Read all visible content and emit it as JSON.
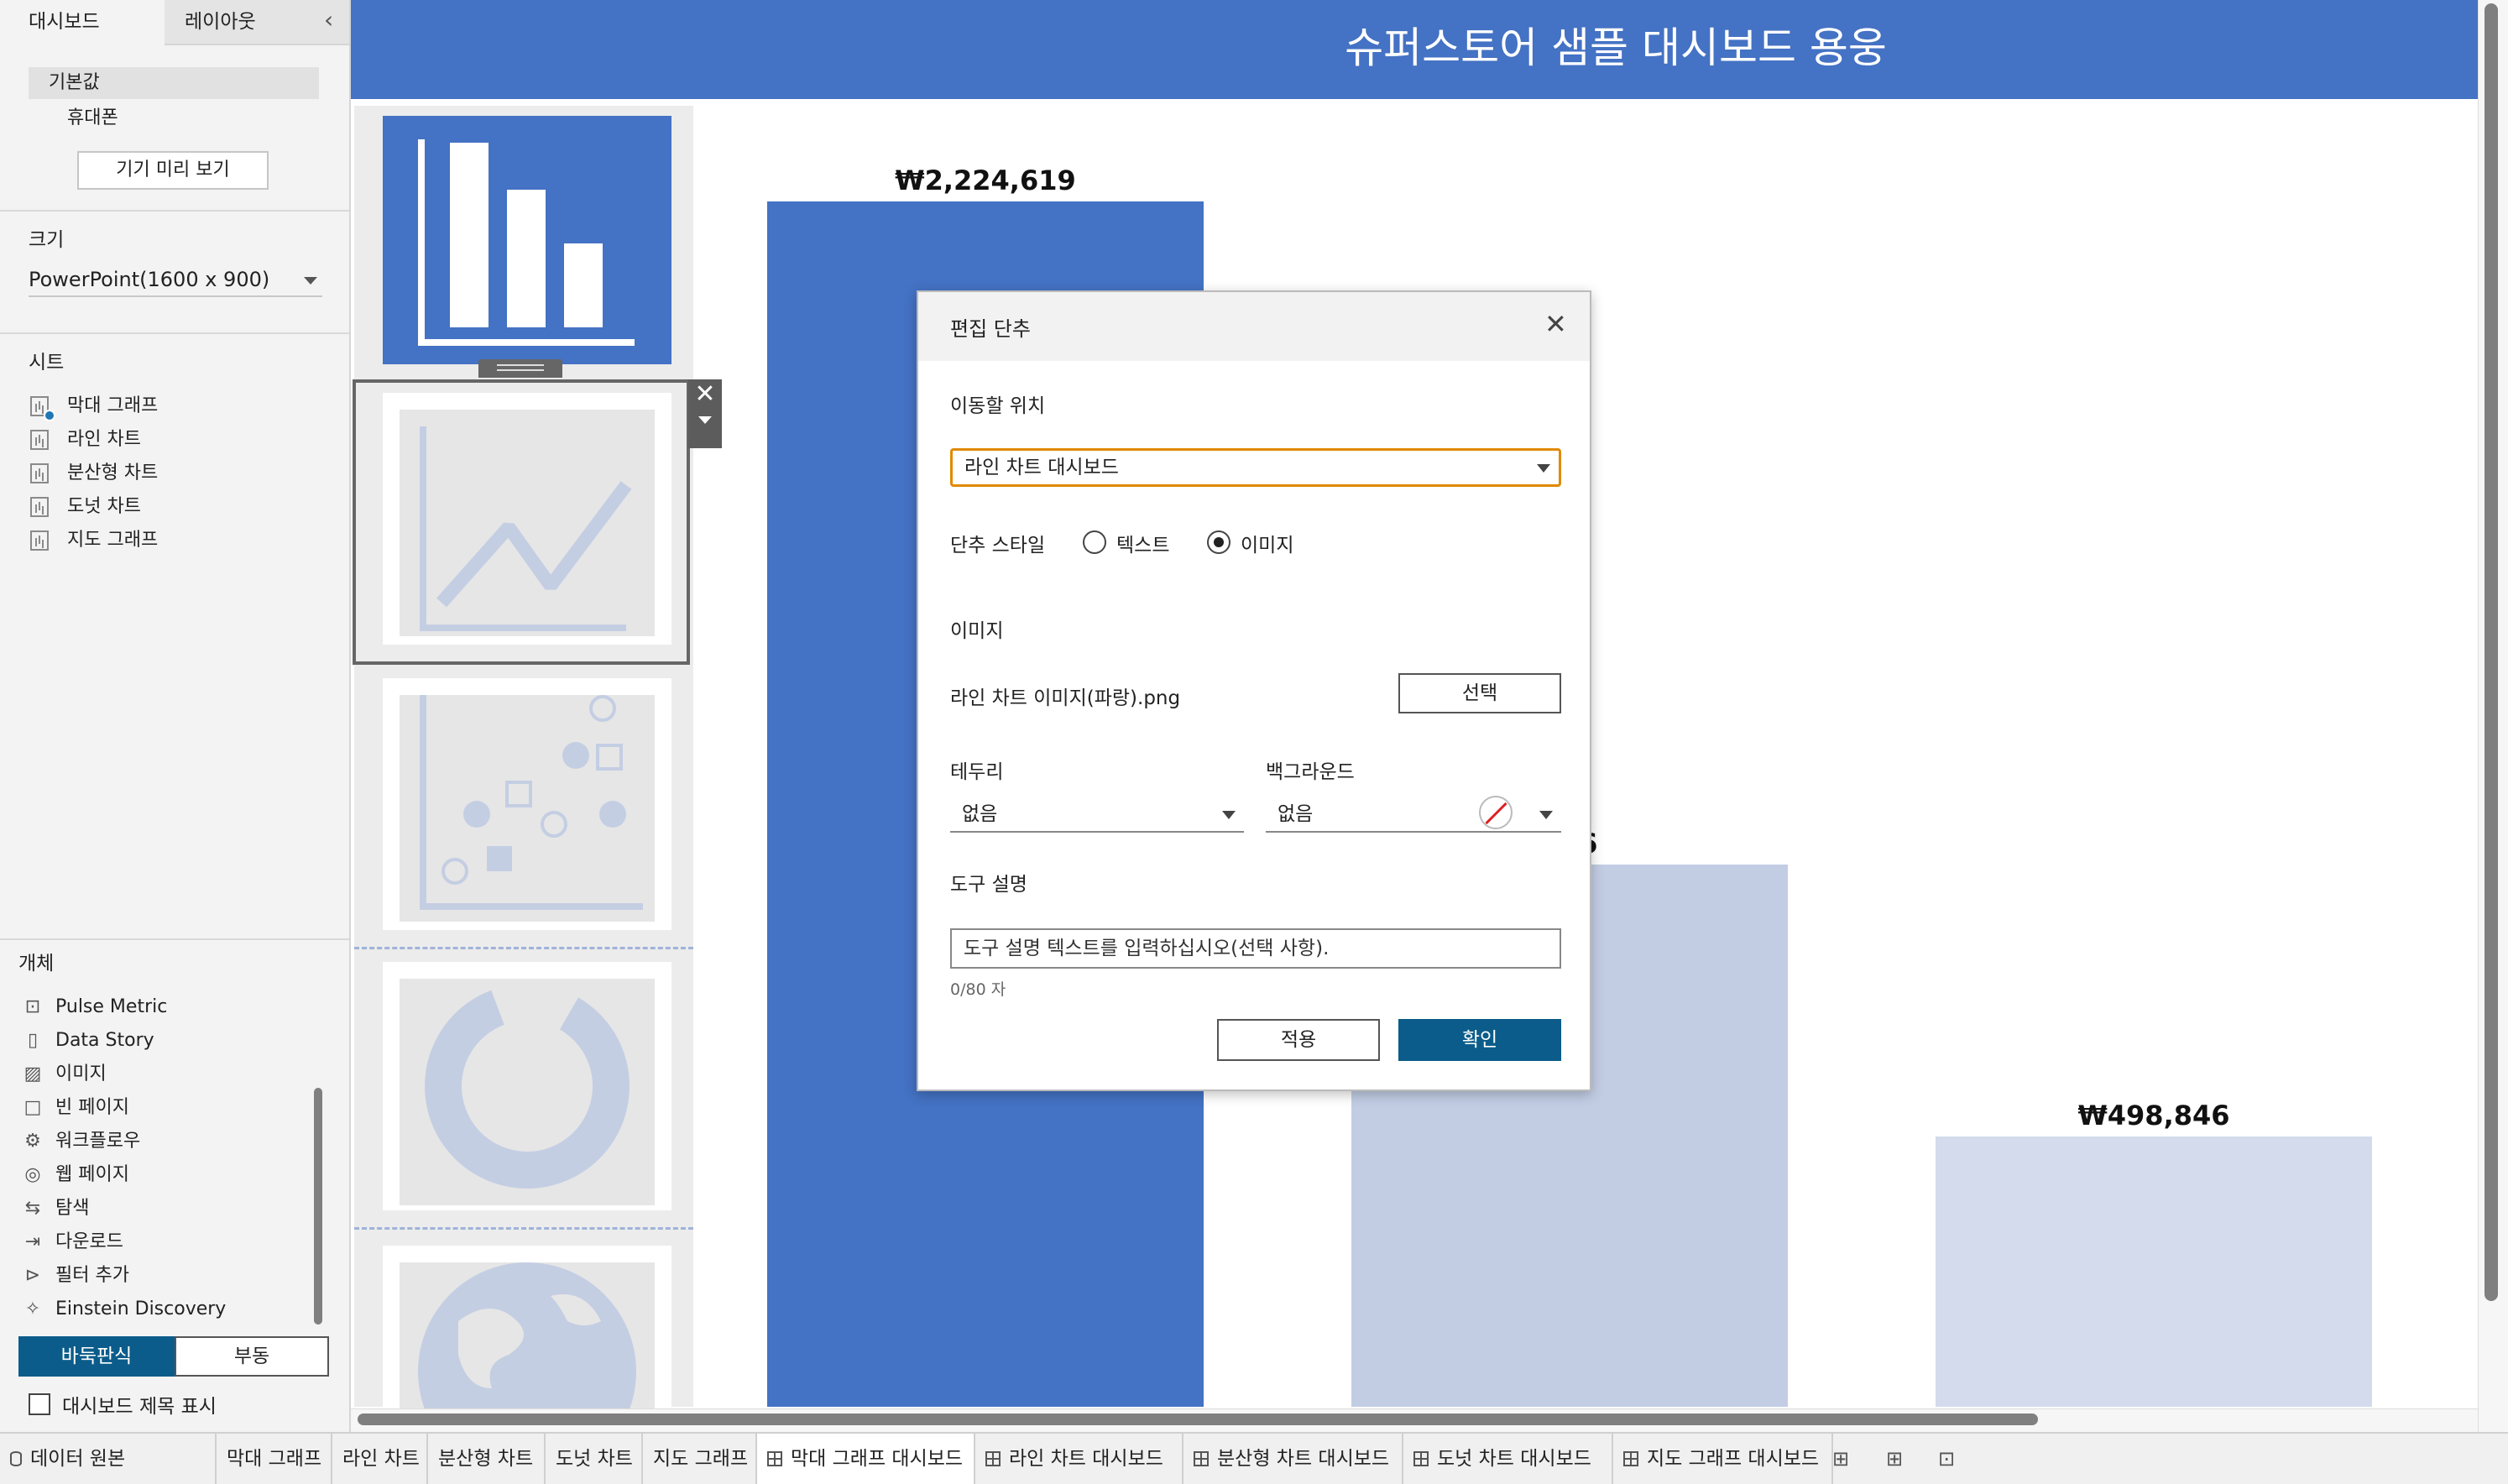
{
  "left_panel": {
    "tabs": [
      "대시보드",
      "레이아웃"
    ],
    "collapse_glyph": "‹",
    "device": {
      "default": "기본값",
      "phone": "휴대폰",
      "preview_button": "기기 미리 보기"
    },
    "size": {
      "heading": "크기",
      "value": "PowerPoint(1600 x 900)"
    },
    "sheets": {
      "heading": "시트",
      "items": [
        "막대 그래프",
        "라인 차트",
        "분산형 차트",
        "도넛 차트",
        "지도 그래프"
      ]
    },
    "objects": {
      "heading": "개체",
      "items": [
        {
          "label": "Pulse Metric",
          "icon": "pulse-metric-icon",
          "glyph": "⊡"
        },
        {
          "label": "Data Story",
          "icon": "data-story-icon",
          "glyph": "▯"
        },
        {
          "label": "이미지",
          "icon": "image-icon",
          "glyph": "▨"
        },
        {
          "label": "빈 페이지",
          "icon": "blank-page-icon",
          "glyph": "□"
        },
        {
          "label": "워크플로우",
          "icon": "workflow-icon",
          "glyph": "⚙"
        },
        {
          "label": "웹 페이지",
          "icon": "globe-icon",
          "glyph": "◎"
        },
        {
          "label": "탐색",
          "icon": "navigation-icon",
          "glyph": "⇆"
        },
        {
          "label": "다운로드",
          "icon": "download-icon",
          "glyph": "⇥"
        },
        {
          "label": "필터 추가",
          "icon": "add-filter-icon",
          "glyph": "⊳"
        },
        {
          "label": "Einstein Discovery",
          "icon": "einstein-icon",
          "glyph": "✧"
        }
      ]
    },
    "layout_mode": {
      "tiled": "바둑판식",
      "floating": "부동"
    },
    "show_title": "대시보드 제목 표시"
  },
  "header": {
    "title": "슈퍼스토어 샘플 대시보드 용웅",
    "color": "#4472c4"
  },
  "chart_data": {
    "type": "bar",
    "categories": [
      "",
      "",
      ""
    ],
    "values": [
      2224619,
      1000000,
      498846
    ],
    "data_labels": [
      "₩2,224,619",
      "926",
      "₩498,846"
    ],
    "colors": [
      "#4472c4",
      "#c2cde4",
      "#d3dbec"
    ]
  },
  "dialog": {
    "title": "편집 단추",
    "close_glyph": "✕",
    "target_label": "이동할 위치",
    "target_value": "라인 차트 대시보드",
    "style_label": "단추 스타일",
    "style_options": [
      "텍스트",
      "이미지"
    ],
    "style_selected": "이미지",
    "image_label": "이미지",
    "image_file": "라인 차트 이미지(파랑).png",
    "choose_button": "선택",
    "border_label": "테두리",
    "border_value": "없음",
    "background_label": "백그라운드",
    "background_value": "없음",
    "tooltip_label": "도구 설명",
    "tooltip_placeholder": "도구 설명 텍스트를 입력하십시오(선택 사항).",
    "counter": "0/80 자",
    "apply_button": "적용",
    "ok_button": "확인"
  },
  "bottom_tabs": {
    "data_source": "데이터 원본",
    "sheets": [
      "막대 그래프",
      "라인 차트",
      "분산형 차트",
      "도넛 차트",
      "지도 그래프"
    ],
    "dashboards": [
      "막대 그래프 대시보드",
      "라인 차트 대시보드",
      "분산형 차트 대시보드",
      "도넛 차트 대시보드",
      "지도 그래프 대시보드"
    ],
    "active": "막대 그래프 대시보드"
  }
}
